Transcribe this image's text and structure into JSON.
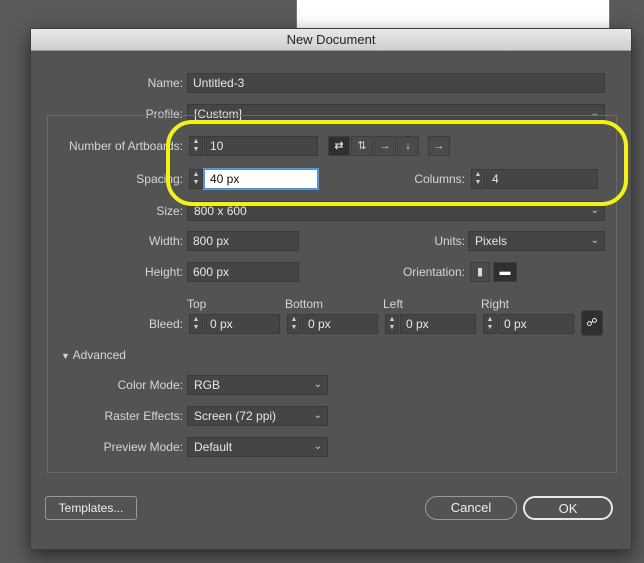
{
  "dialog": {
    "title": "New Document"
  },
  "name": {
    "label": "Name:",
    "value": "Untitled-3"
  },
  "profile": {
    "label": "Profile:",
    "value": "[Custom]"
  },
  "artboards": {
    "label": "Number of Artboards:",
    "value": "10"
  },
  "spacing": {
    "label": "Spacing:",
    "value": "40 px"
  },
  "columns": {
    "label": "Columns:",
    "value": "4"
  },
  "size": {
    "label": "Size:",
    "value": "800 x 600"
  },
  "width": {
    "label": "Width:",
    "value": "800 px"
  },
  "height": {
    "label": "Height:",
    "value": "600 px"
  },
  "units": {
    "label": "Units:",
    "value": "Pixels"
  },
  "orientation": {
    "label": "Orientation:"
  },
  "bleed": {
    "label": "Bleed:",
    "top": {
      "label": "Top",
      "value": "0 px"
    },
    "bottom": {
      "label": "Bottom",
      "value": "0 px"
    },
    "left": {
      "label": "Left",
      "value": "0 px"
    },
    "right": {
      "label": "Right",
      "value": "0 px"
    }
  },
  "advanced": {
    "label": "Advanced"
  },
  "color_mode": {
    "label": "Color Mode:",
    "value": "RGB"
  },
  "raster_effects": {
    "label": "Raster Effects:",
    "value": "Screen (72 ppi)"
  },
  "preview_mode": {
    "label": "Preview Mode:",
    "value": "Default"
  },
  "buttons": {
    "templates": "Templates...",
    "cancel": "Cancel",
    "ok": "OK"
  },
  "colors": {
    "highlight": "#f2f21a",
    "dialog_bg": "#535353",
    "active_field": "#ffffff"
  }
}
